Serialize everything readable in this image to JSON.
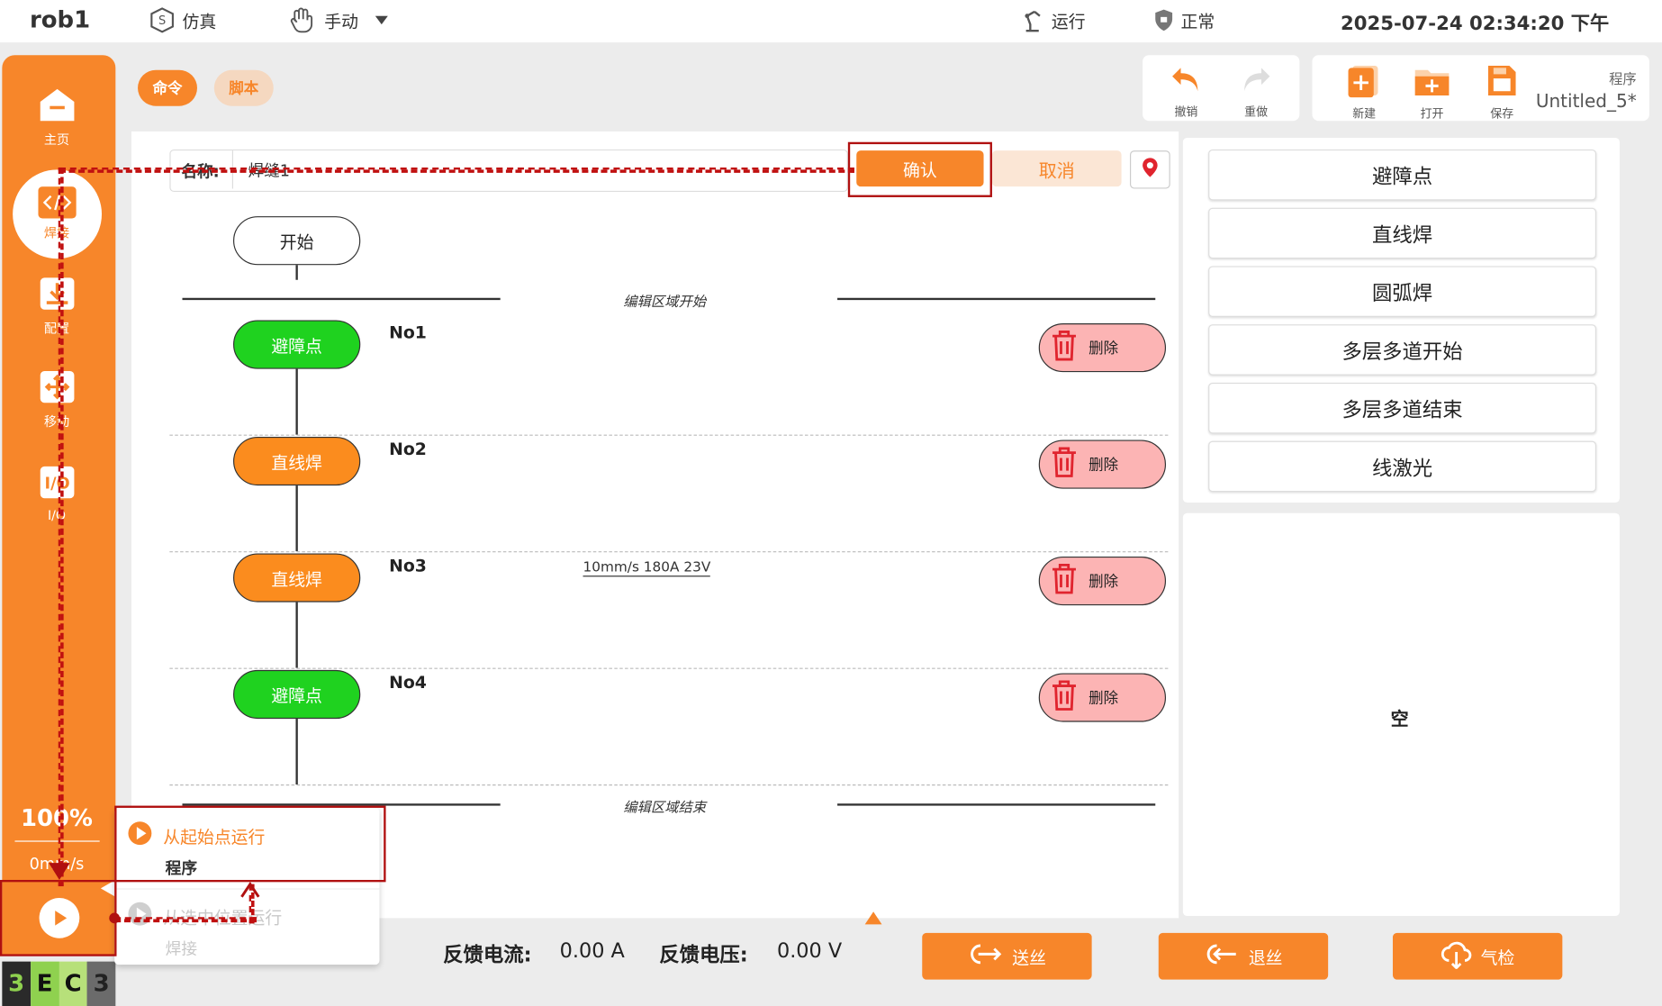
{
  "topbar": {
    "robot_name": "rob1",
    "mode": "仿真",
    "control": "手动",
    "state": "运行",
    "status": "正常",
    "datetime": "2025-07-24 02:34:20 下午"
  },
  "tabs": {
    "command": "命令",
    "script": "脚本"
  },
  "toolbar": {
    "undo": "撤销",
    "redo": "重做",
    "new": "新建",
    "open": "打开",
    "save": "保存",
    "program_label": "程序",
    "program_name": "Untitled_5*"
  },
  "sidebar": {
    "items": [
      {
        "label": "主页",
        "icon": "home-icon"
      },
      {
        "label": "焊接",
        "icon": "code-icon"
      },
      {
        "label": "配置",
        "icon": "download-icon"
      },
      {
        "label": "移动",
        "icon": "move-icon"
      },
      {
        "label": "I/O",
        "icon": "io-icon"
      }
    ],
    "speed_percent": "100%",
    "speed_value": "0mm/s"
  },
  "editor": {
    "name_label": "名称:",
    "name_value": "焊缝1",
    "confirm": "确认",
    "cancel": "取消",
    "start": "开始",
    "region_start": "编辑区域开始",
    "region_end": "编辑区域结束",
    "delete_label": "删除",
    "steps": [
      {
        "no": "No1",
        "label": "避障点",
        "color": "#1fd21f",
        "param": ""
      },
      {
        "no": "No2",
        "label": "直线焊",
        "color": "#fb8c1e",
        "param": ""
      },
      {
        "no": "No3",
        "label": "直线焊",
        "color": "#fb8c1e",
        "param": "10mm/s 180A 23V"
      },
      {
        "no": "No4",
        "label": "避障点",
        "color": "#1fd21f",
        "param": ""
      }
    ]
  },
  "commands": [
    "避障点",
    "直线焊",
    "圆弧焊",
    "多层多道开始",
    "多层多道结束",
    "线激光"
  ],
  "empty_text": "空",
  "status_bar": {
    "current_label": "反馈电流:",
    "current_value": "0.00 A",
    "voltage_label": "反馈电压:",
    "voltage_value": "0.00 V",
    "feed": "送丝",
    "retract": "退丝",
    "gas": "气检"
  },
  "run_menu": {
    "option1_title": "从起始点运行",
    "option1_sub": "程序",
    "option2_title": "从选中位置运行",
    "option2_sub": "焊接"
  },
  "logo_chars": [
    "3",
    "E",
    "C",
    "3"
  ],
  "colors": {
    "accent": "#f7862a",
    "green_node": "#1fd21f",
    "orange_node": "#fb8c1e",
    "delete": "#fcb4b4",
    "annotation": "#b01010"
  }
}
